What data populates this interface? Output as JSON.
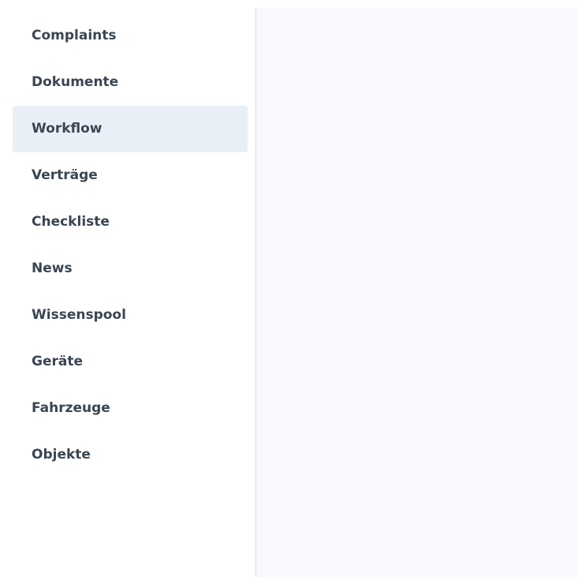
{
  "sidebar": {
    "items": [
      {
        "label": "Complaints",
        "active": false
      },
      {
        "label": "Dokumente",
        "active": false
      },
      {
        "label": "Workflow",
        "active": true
      },
      {
        "label": "Verträge",
        "active": false
      },
      {
        "label": "Checkliste",
        "active": false
      },
      {
        "label": "News",
        "active": false
      },
      {
        "label": "Wissenspool",
        "active": false
      },
      {
        "label": "Geräte",
        "active": false
      },
      {
        "label": "Fahrzeuge",
        "active": false
      },
      {
        "label": "Objekte",
        "active": false
      }
    ],
    "active_background": "#e8eff7",
    "text_color": "#3a4652"
  },
  "content": {
    "background": "#f9fafd"
  }
}
